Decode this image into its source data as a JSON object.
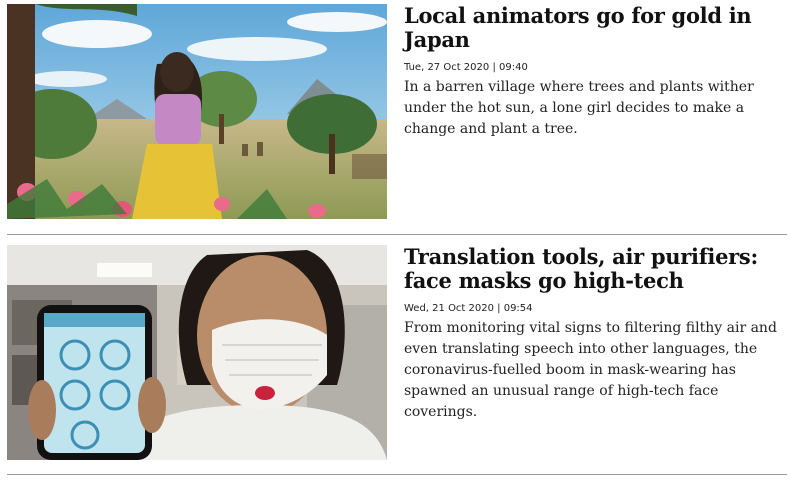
{
  "articles": [
    {
      "headline": "Local animators go for gold in Japan",
      "date": "Tue, 27 Oct 2020 | 09:40",
      "summary": "In a barren village where trees and plants wither under the hot sun, a lone girl decides to make a change and plant a tree."
    },
    {
      "headline": "Translation tools, air purifiers: face masks go high-tech",
      "date": "Wed, 21 Oct 2020 | 09:54",
      "summary": "From monitoring vital signs to filtering filthy air and even translating speech into other languages, the coronavirus-fuelled boom in mask-wearing has spawned an unusual range of high-tech face coverings."
    }
  ]
}
